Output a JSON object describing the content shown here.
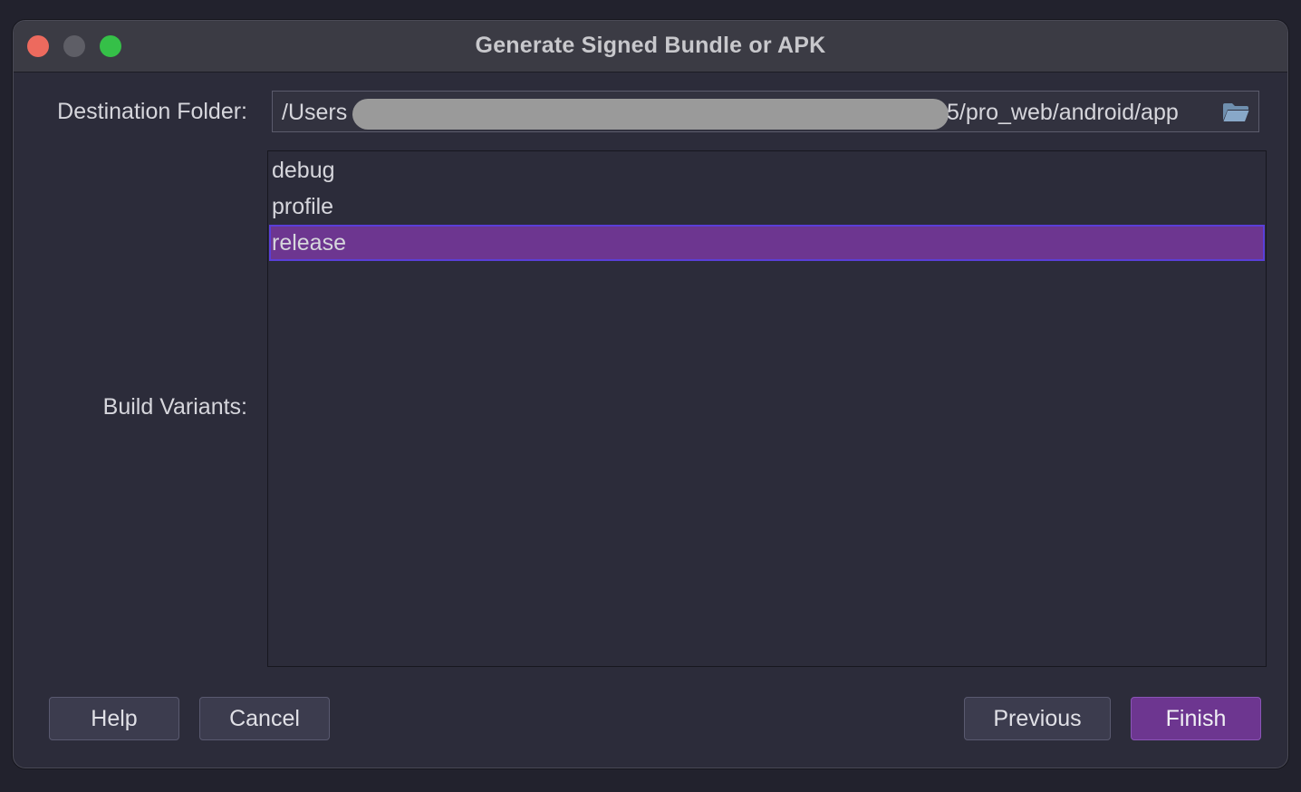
{
  "window": {
    "title": "Generate Signed Bundle or APK"
  },
  "destination": {
    "label": "Destination Folder:",
    "path_start": "/Users",
    "path_end": "5/pro_web/android/app",
    "icon": "folder-icon"
  },
  "build_variants": {
    "label": "Build Variants:",
    "items": [
      {
        "label": "debug",
        "selected": false
      },
      {
        "label": "profile",
        "selected": false
      },
      {
        "label": "release",
        "selected": true
      }
    ]
  },
  "buttons": {
    "help": "Help",
    "cancel": "Cancel",
    "previous": "Previous",
    "finish": "Finish"
  },
  "colors": {
    "selection": "#6d3690",
    "accent_button": "#6d3690",
    "close": "#ed6a5e",
    "maximize": "#35c048"
  }
}
